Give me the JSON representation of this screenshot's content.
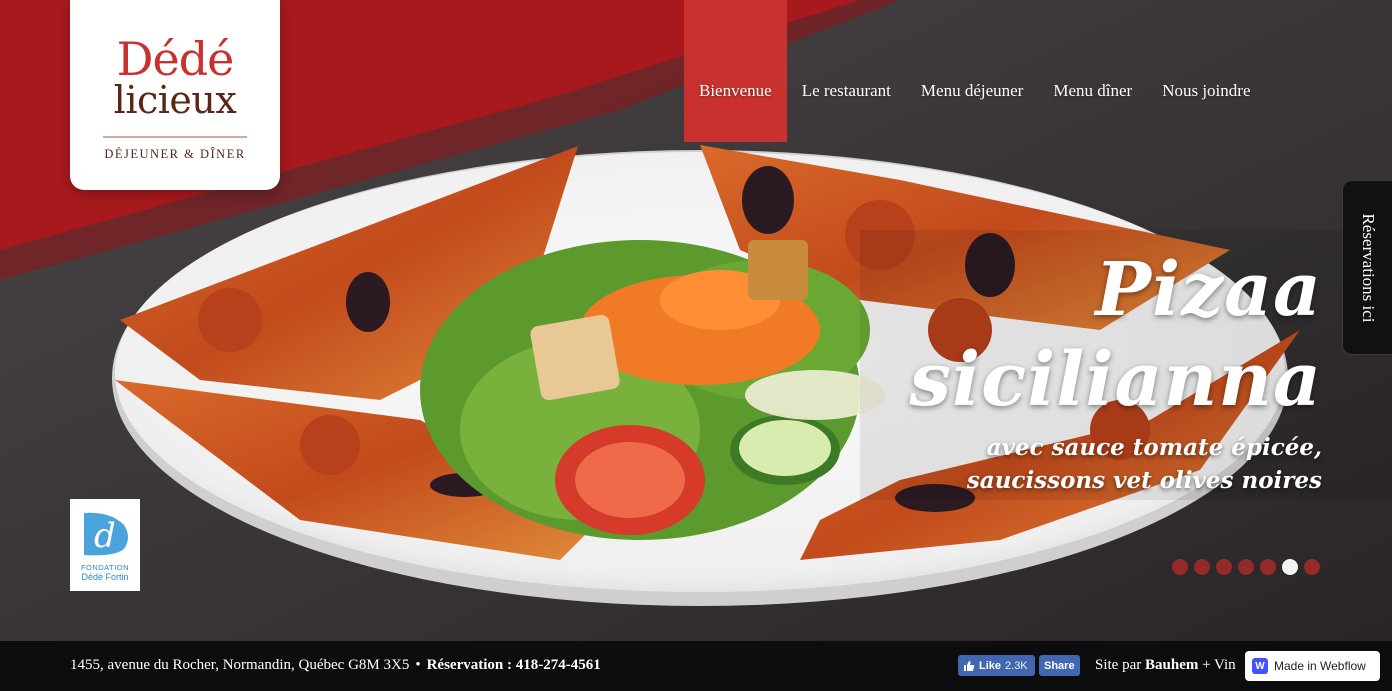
{
  "logo": {
    "line1": "Dédé",
    "line2": "licieux",
    "tagline": "DÉJEUNER & DÎNER"
  },
  "nav": {
    "items": [
      {
        "label": "Bienvenue",
        "active": true
      },
      {
        "label": "Le restaurant",
        "active": false
      },
      {
        "label": "Menu déjeuner",
        "active": false
      },
      {
        "label": "Menu dîner",
        "active": false
      },
      {
        "label": "Nous joindre",
        "active": false
      }
    ]
  },
  "reservation_tab": {
    "label": "Réservations ici"
  },
  "slide": {
    "title_line1": "Pizaa",
    "title_line2": "sicilianna",
    "subtitle_line1": "avec sauce tomate épicée,",
    "subtitle_line2": "saucissons vet olives noires",
    "dots_total": 7,
    "active_dot": 6
  },
  "fondation": {
    "line1": "FONDATION",
    "line2": "Dédé Fortin"
  },
  "footer": {
    "address": "1455, avenue du Rocher, Normandin, Québec G8M 3X5",
    "bullet": "•",
    "reservation": "Réservation : 418-274-4561",
    "fb_like_label": "Like",
    "fb_like_count": "2.3K",
    "fb_share_label": "Share",
    "site_par_prefix": "Site par ",
    "site_par_name": "Bauhem",
    "site_par_suffix": " + Vin",
    "webflow_badge": "Made in Webflow"
  },
  "colors": {
    "brand_red": "#c8312d",
    "brand_brown": "#5a2616",
    "footer_bg": "#0d0d0d",
    "facebook_blue": "#4267b2",
    "webflow_blue": "#4353ff"
  }
}
